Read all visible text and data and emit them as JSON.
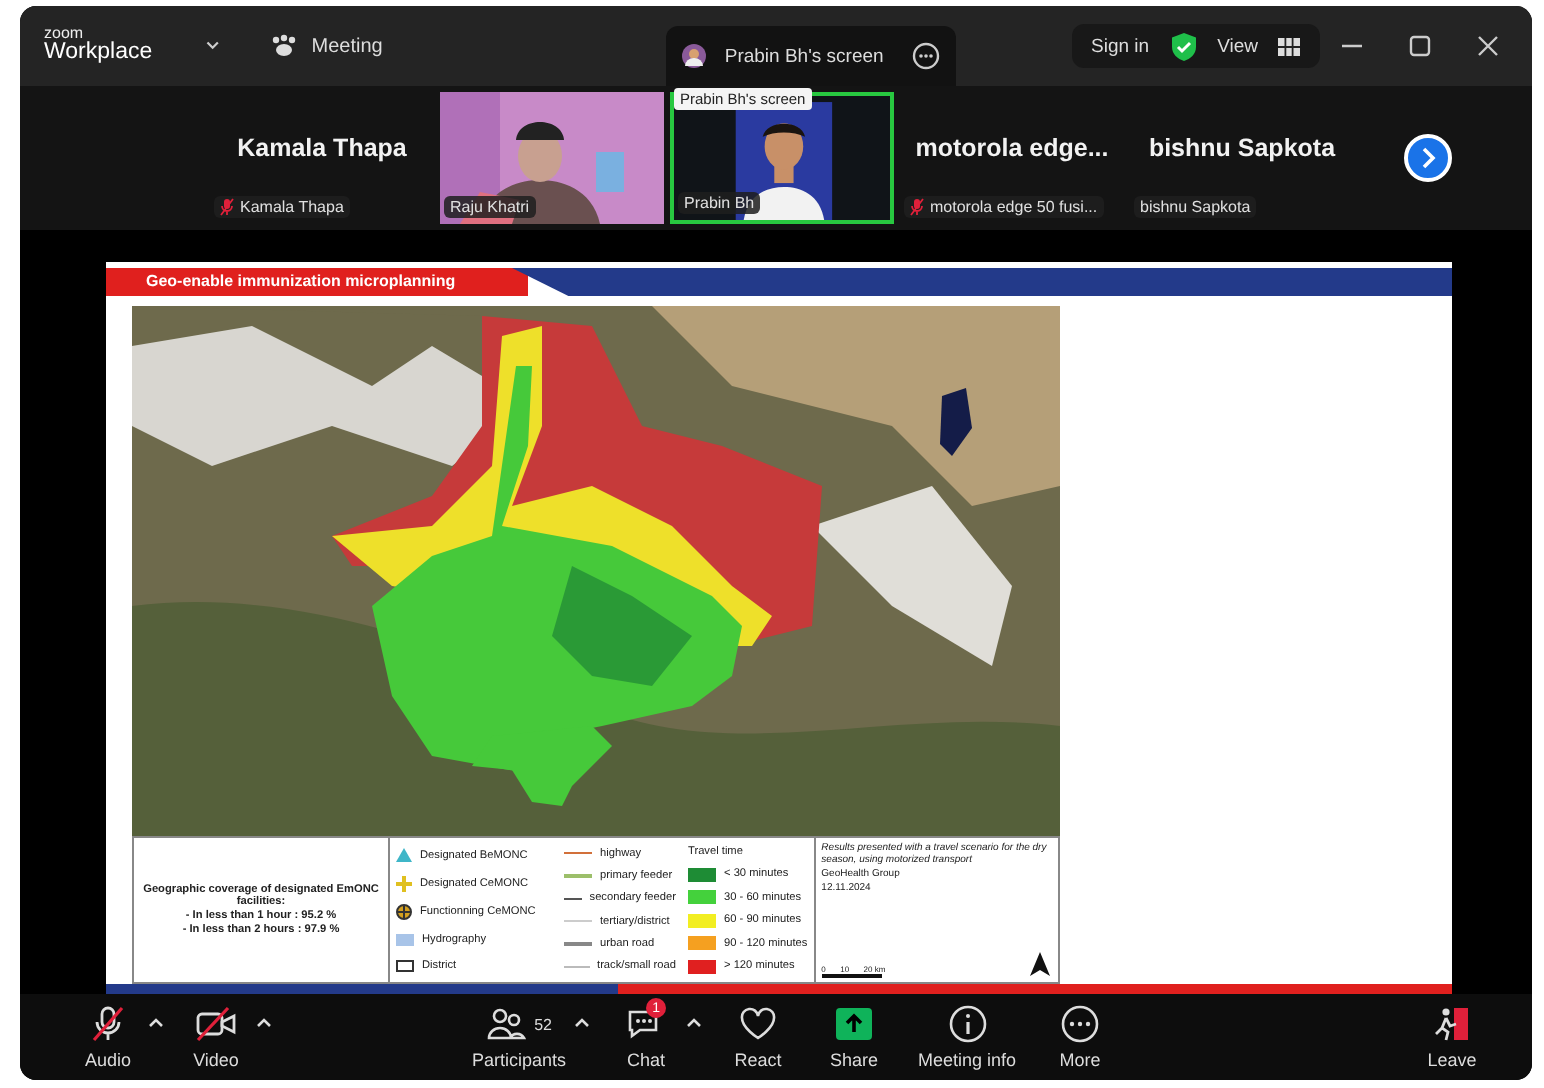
{
  "title_bar": {
    "logo_top": "zoom",
    "logo_bottom": "Workplace",
    "menu": "Meeting",
    "share_tab": "Prabin Bh's screen",
    "sign_in": "Sign in",
    "view": "View"
  },
  "participants": [
    {
      "kind": "name",
      "display": "Kamala Thapa",
      "label": "Kamala Thapa",
      "muted": true,
      "selected": false
    },
    {
      "kind": "video",
      "label": "Raju Khatri",
      "muted": false,
      "selected": false
    },
    {
      "kind": "video",
      "label": "Prabin Bh",
      "muted": false,
      "selected": true
    },
    {
      "kind": "name",
      "display": "motorola edge...",
      "label": "motorola edge 50 fusi...",
      "muted": true,
      "selected": false
    },
    {
      "kind": "name",
      "display": "bishnu Sapkota",
      "label": "bishnu Sapkota",
      "muted": false,
      "selected": false
    }
  ],
  "tooltip": "Prabin Bh's screen",
  "slide": {
    "title": "Geo-enable immunization microplanning",
    "coverage": {
      "heading": "Geographic coverage of designated EmONC facilities:",
      "lines": [
        "- In less than 1 hour : 95.2 %",
        "- In less than 2 hours : 97.9 %"
      ]
    },
    "symbols": [
      {
        "kind": "triangle",
        "label": "Designated BeMONC",
        "color": "#3fb6c8"
      },
      {
        "kind": "cross",
        "label": "Designated CeMONC",
        "color": "#e0c020"
      },
      {
        "kind": "circle-cross",
        "label": "Functionning CeMONC",
        "color": "#333333"
      },
      {
        "kind": "fill",
        "label": "Hydrography",
        "color": "#a8c4e8"
      },
      {
        "kind": "outline",
        "label": "District",
        "color": "#333333"
      }
    ],
    "roads": [
      {
        "label": "highway",
        "color": "#d2703a"
      },
      {
        "label": "primary feeder",
        "color": "#9cbf6a"
      },
      {
        "label": "secondary feeder",
        "color": "#555555"
      },
      {
        "label": "tertiary/district",
        "color": "#cccccc"
      },
      {
        "label": "urban road",
        "color": "#888888"
      },
      {
        "label": "track/small road",
        "color": "#bbbbbb"
      }
    ],
    "travel_title": "Travel time",
    "travel": [
      {
        "label": "< 30 minutes",
        "color": "#1e8c35"
      },
      {
        "label": "30 - 60 minutes",
        "color": "#44d13c"
      },
      {
        "label": "60 - 90 minutes",
        "color": "#f2ee22"
      },
      {
        "label": "90 - 120 minutes",
        "color": "#f5a020"
      },
      {
        "label": "> 120 minutes",
        "color": "#e02020"
      }
    ],
    "note": "Results presented with a travel scenario for the dry season, using motorized transport",
    "credit": "GeoHealth Group",
    "date": "12.11.2024",
    "scale": [
      "0",
      "10",
      "20 km"
    ]
  },
  "toolbar": [
    {
      "kind": "audio",
      "label": "Audio",
      "off": true,
      "has_menu": true
    },
    {
      "kind": "video",
      "label": "Video",
      "off": true,
      "has_menu": true
    },
    {
      "kind": "participants",
      "label": "Participants",
      "count": "52",
      "has_menu": true
    },
    {
      "kind": "chat",
      "label": "Chat",
      "badge": "1",
      "has_menu": true
    },
    {
      "kind": "react",
      "label": "React",
      "has_menu": false
    },
    {
      "kind": "share",
      "label": "Share",
      "has_menu": false
    },
    {
      "kind": "info",
      "label": "Meeting info",
      "has_menu": false
    },
    {
      "kind": "more",
      "label": "More",
      "has_menu": false
    },
    {
      "kind": "leave",
      "label": "Leave",
      "has_menu": false
    }
  ]
}
